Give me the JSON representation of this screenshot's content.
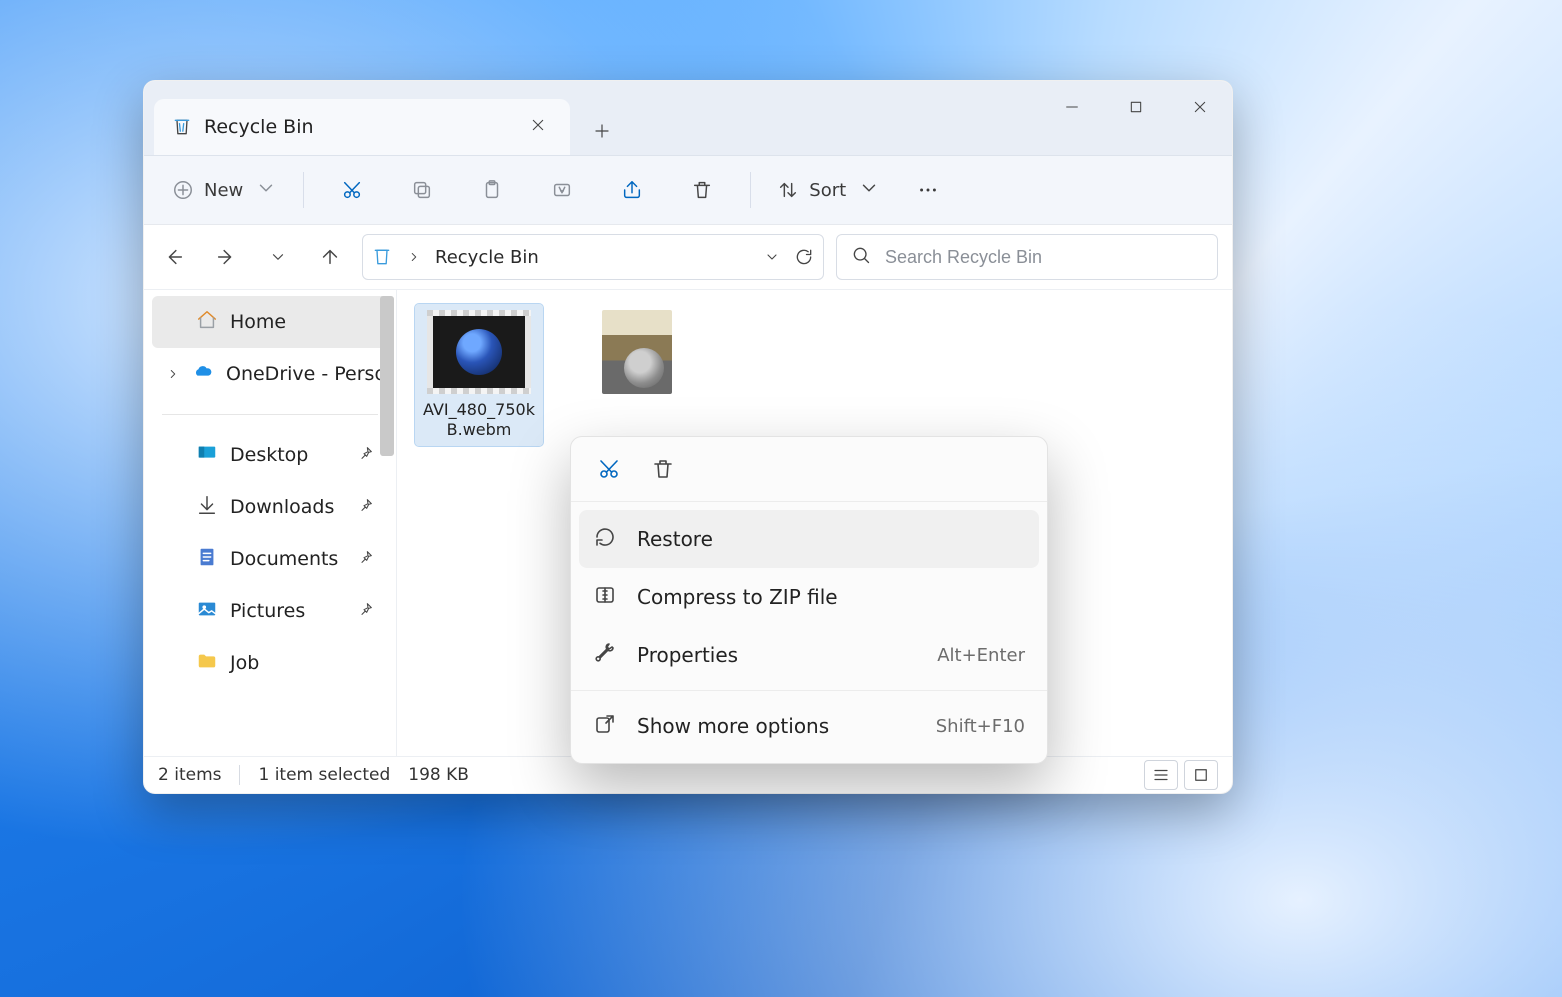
{
  "window": {
    "tab_title": "Recycle Bin"
  },
  "toolbar": {
    "new_label": "New",
    "sort_label": "Sort"
  },
  "address": {
    "location": "Recycle Bin"
  },
  "search": {
    "placeholder": "Search Recycle Bin"
  },
  "sidebar": {
    "home": "Home",
    "onedrive": "OneDrive - Perso",
    "desktop": "Desktop",
    "downloads": "Downloads",
    "documents": "Documents",
    "pictures": "Pictures",
    "job": "Job"
  },
  "files": {
    "f0": {
      "name": "AVI_480_750kB.webm"
    },
    "f1": {
      "name": ""
    }
  },
  "status": {
    "count": "2 items",
    "selection": "1 item selected",
    "size": "198 KB"
  },
  "context_menu": {
    "restore": "Restore",
    "compress": "Compress to ZIP file",
    "properties": "Properties",
    "properties_shortcut": "Alt+Enter",
    "more": "Show more options",
    "more_shortcut": "Shift+F10"
  }
}
